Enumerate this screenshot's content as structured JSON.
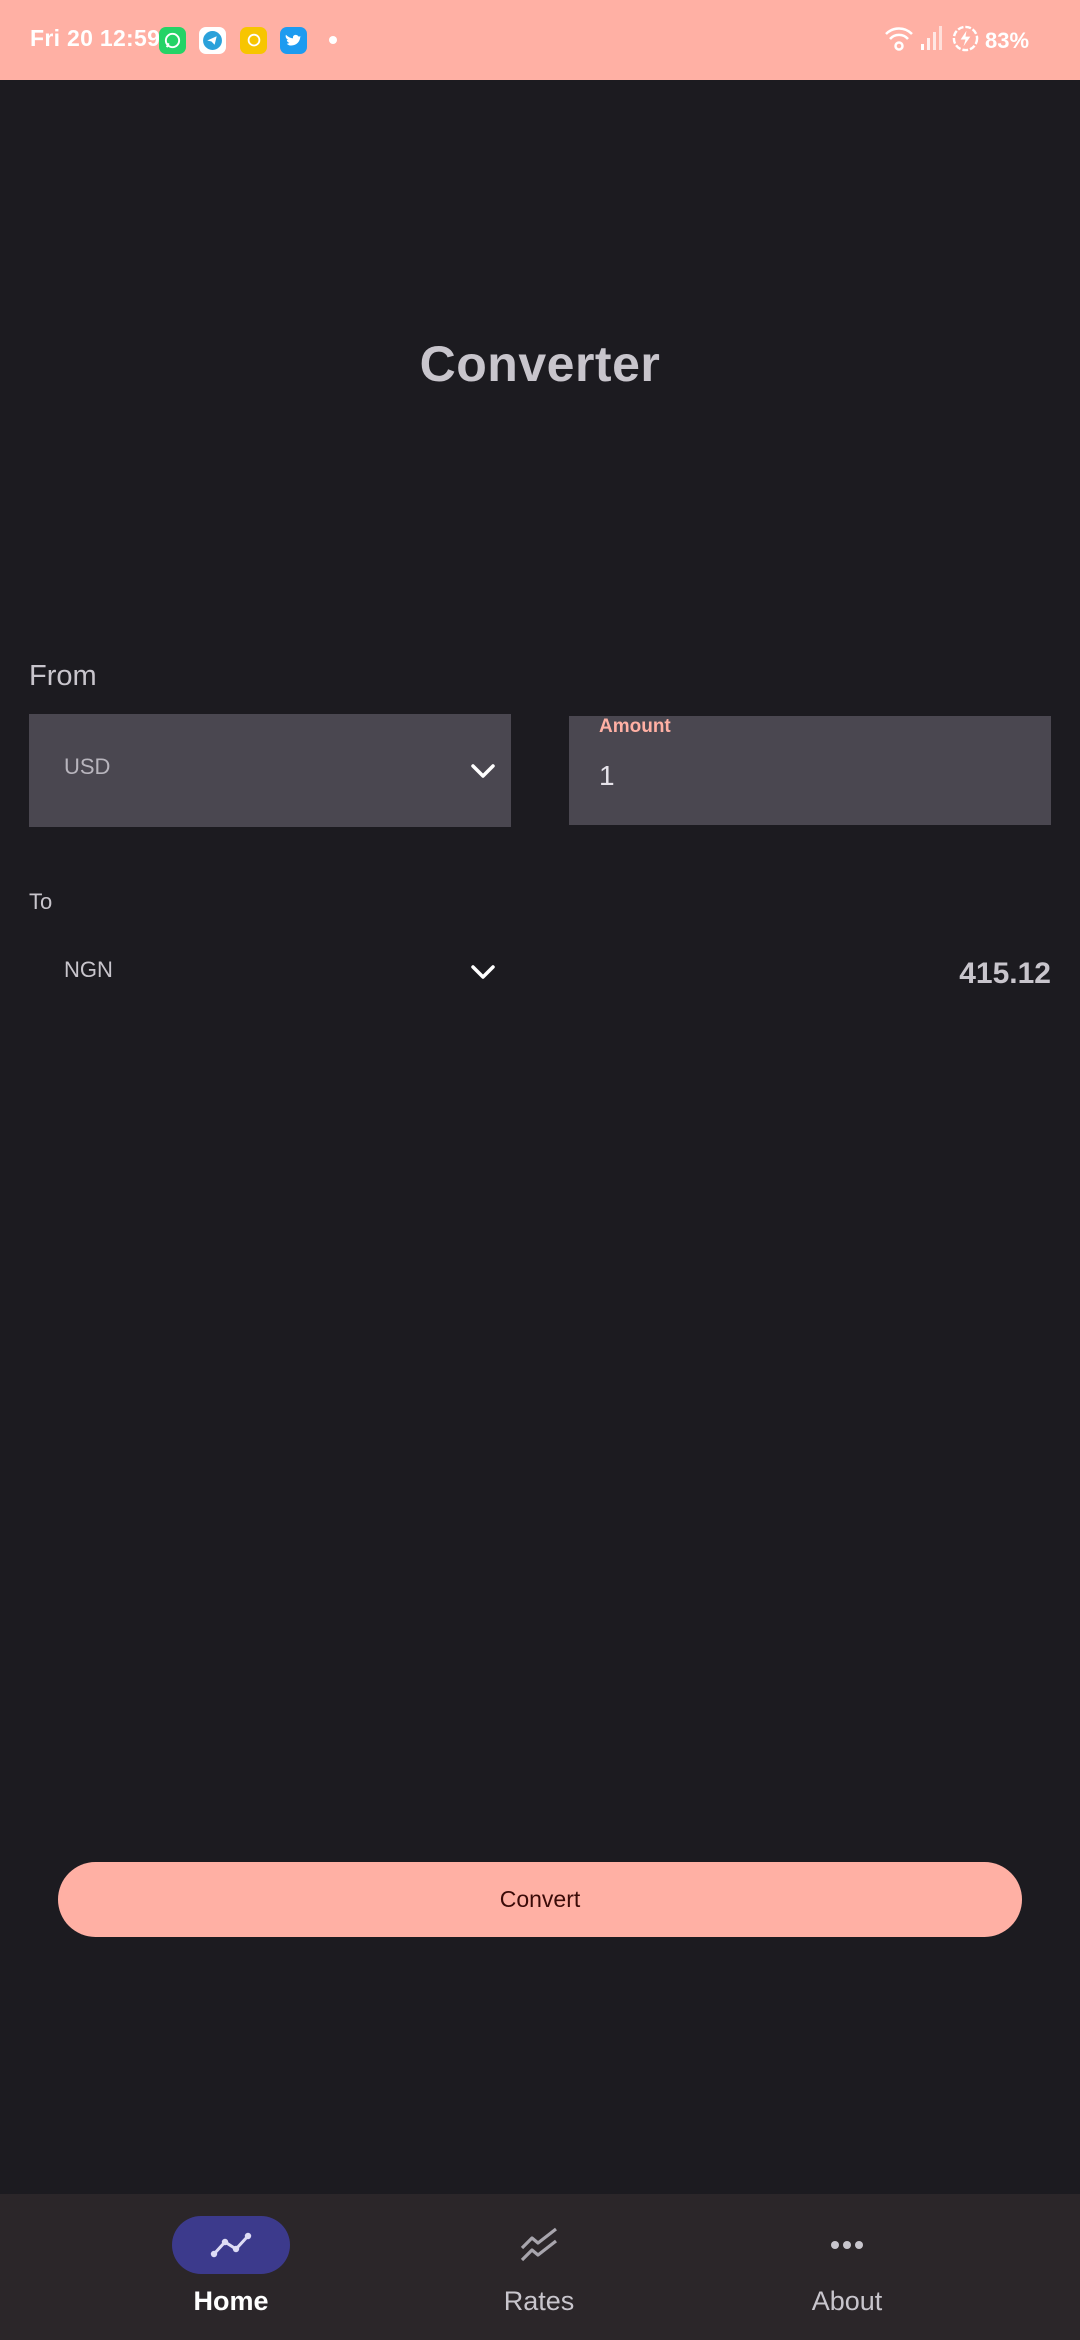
{
  "status_bar": {
    "time": "Fri 20 12:59",
    "battery": "83%",
    "notification_icons": [
      "whatsapp-icon",
      "telegram-icon",
      "snapchat-icon",
      "twitter-icon"
    ],
    "system_icons": [
      "wifi-icon",
      "signal-icon",
      "battery-saver-icon"
    ]
  },
  "header": {
    "title": "Converter"
  },
  "from": {
    "label": "From",
    "currency": "USD",
    "amount_label": "Amount",
    "amount_value": "1"
  },
  "to": {
    "label": "To",
    "currency": "NGN",
    "result": "415.12"
  },
  "actions": {
    "convert_label": "Convert"
  },
  "bottom_nav": {
    "items": [
      {
        "label": "Home",
        "icon": "chart-line-icon",
        "active": true
      },
      {
        "label": "Rates",
        "icon": "trending-icon",
        "active": false
      },
      {
        "label": "About",
        "icon": "more-horiz-icon",
        "active": false
      }
    ]
  },
  "colors": {
    "accent": "#ffb0a4",
    "background": "#1c1b20",
    "field": "#4a4750",
    "nav_background": "#2b2629",
    "nav_active_pill": "#3c3a8c",
    "convert_text": "#3a0b08"
  }
}
